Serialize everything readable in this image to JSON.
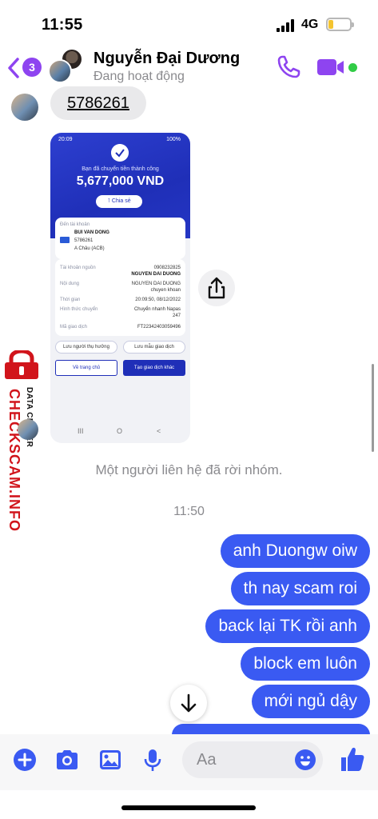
{
  "status_bar": {
    "time": "11:55",
    "network": "4G"
  },
  "header": {
    "unread_count": "3",
    "contact_name": "Nguyễn Đại Dương",
    "presence": "Đang hoạt động",
    "online_color": "#31cc46",
    "accent_color": "#8e44f0"
  },
  "messages": {
    "incoming_text": "5786261",
    "receipt": {
      "status_time": "20:09",
      "battery": "100%",
      "success_text": "Bạn đã chuyển tiền thành công",
      "amount": "5,677,000 VND",
      "share_label": "Chia sẻ",
      "to_account_label": "Đến tài khoản",
      "recipient_name": "BUI VAN DONG",
      "recipient_account": "5786261",
      "recipient_bank": "A Châu (ACB)",
      "source_label": "Tài khoản nguồn",
      "source_account": "0908232825",
      "source_name": "NGUYEN DAI DUONG",
      "content_label": "Nội dung",
      "content_value_1": "NGUYEN DAI DUONG",
      "content_value_2": "chuyen khoan",
      "time_label": "Thời gian",
      "time_value": "20:09:50, 08/12/2022",
      "method_label": "Hình thức chuyển",
      "method_value_1": "Chuyển nhanh Napas",
      "method_value_2": "247",
      "txn_label": "Mã giao dịch",
      "txn_value": "FT22342403059496",
      "save_beneficiary": "Lưu người thụ hưởng",
      "save_template": "Lưu mẫu giao dịch",
      "home_button": "Về trang chủ",
      "new_txn_button": "Tạo giao dịch khác",
      "nav": [
        "III",
        "O",
        "<"
      ]
    },
    "system_note": "Một người liên hệ đã rời nhóm.",
    "timestamp": "11:50",
    "outgoing": [
      "anh Duongw oiw",
      "th nay scam roi",
      "back lại TK rồi anh",
      "block em luôn",
      "mới ngủ dậy"
    ],
    "outgoing_color": "#3a5af2"
  },
  "watermark": {
    "title": "CHECKSCAM.INFO",
    "subtitle": "DATA CENTER"
  },
  "composer": {
    "placeholder": "Aa"
  }
}
